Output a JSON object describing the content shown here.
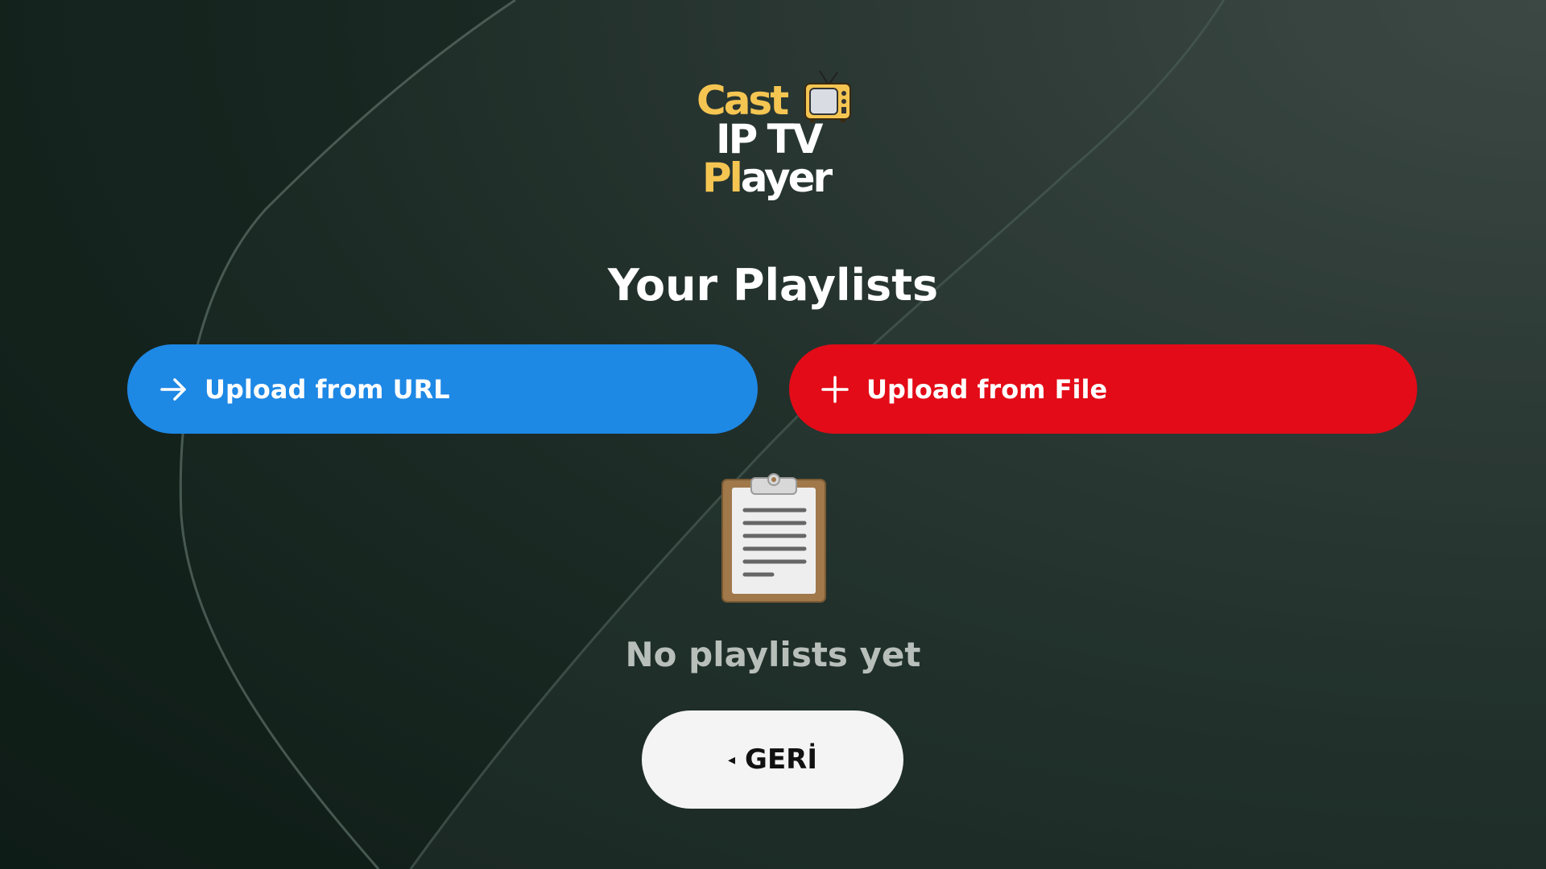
{
  "logo": {
    "line1": "Cast",
    "line2": "IP TV",
    "line3_highlight": "Pl",
    "line3_rest": "ayer",
    "icon": "tv-icon"
  },
  "page_title": "Your Playlists",
  "actions": {
    "upload_url": {
      "label": "Upload from URL",
      "icon": "arrow-right-icon",
      "color": "#1e88e5"
    },
    "upload_file": {
      "label": "Upload from File",
      "icon": "plus-icon",
      "color": "#e30b17"
    }
  },
  "empty_state": {
    "icon": "clipboard-icon",
    "message": "No playlists yet"
  },
  "back_button": {
    "arrow": "◂",
    "label": "GERİ"
  },
  "colors": {
    "logo_yellow": "#f5c552",
    "background": "#1b2a24"
  }
}
